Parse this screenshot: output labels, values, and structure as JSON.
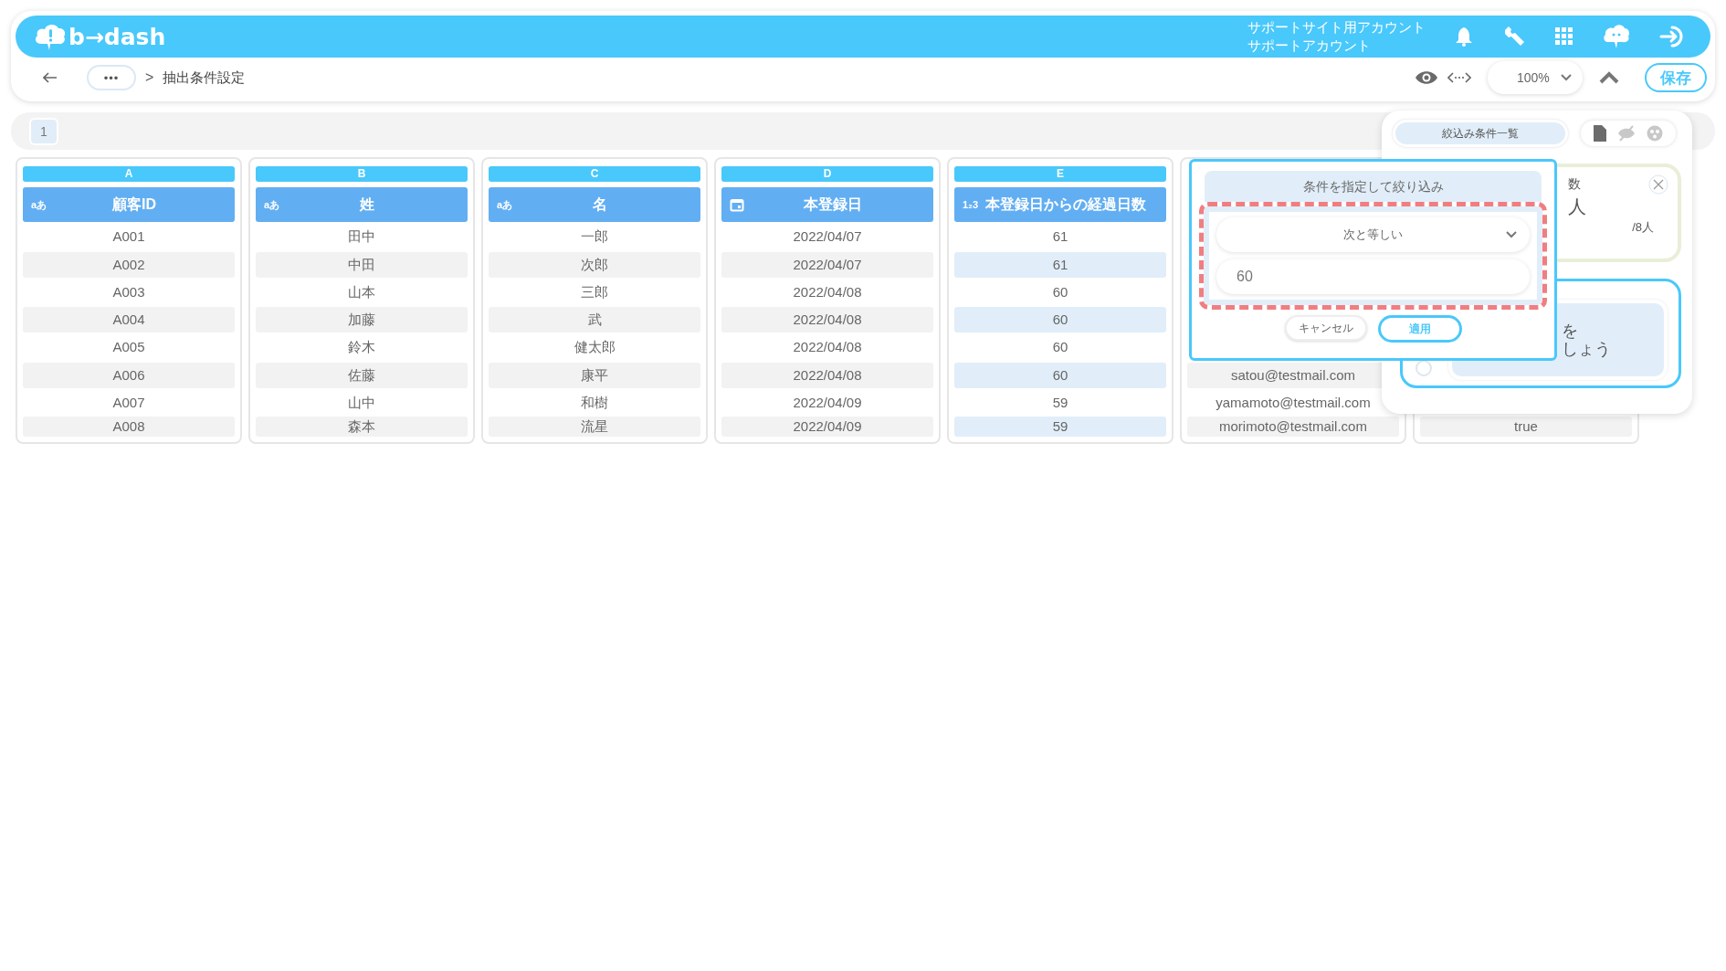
{
  "header": {
    "logo": "b→dash",
    "account_lines": [
      "サポートサイト用アカウント",
      "サポートアカウント"
    ]
  },
  "toolbar": {
    "more": "•••",
    "breadcrumb_separator": ">",
    "breadcrumb": "抽出条件設定",
    "zoom": "100%",
    "save": "保存"
  },
  "page_tabs": [
    {
      "label": "1",
      "selected": true
    }
  ],
  "columns": [
    {
      "letter": "A",
      "kind": "text",
      "type_icon": "aあ",
      "title": "顧客ID",
      "selected": false,
      "cells": [
        "A001",
        "A002",
        "A003",
        "A004",
        "A005",
        "A006",
        "A007",
        "A008"
      ]
    },
    {
      "letter": "B",
      "kind": "text",
      "type_icon": "aあ",
      "title": "姓",
      "selected": false,
      "cells": [
        "田中",
        "中田",
        "山本",
        "加藤",
        "鈴木",
        "佐藤",
        "山中",
        "森本"
      ]
    },
    {
      "letter": "C",
      "kind": "text",
      "type_icon": "aあ",
      "title": "名",
      "selected": false,
      "cells": [
        "一郎",
        "次郎",
        "三郎",
        "武",
        "健太郎",
        "康平",
        "和樹",
        "流星"
      ]
    },
    {
      "letter": "D",
      "kind": "date",
      "title": "本登録日",
      "selected": false,
      "cells": [
        "2022/04/07",
        "2022/04/07",
        "2022/04/08",
        "2022/04/08",
        "2022/04/08",
        "2022/04/08",
        "2022/04/09",
        "2022/04/09"
      ]
    },
    {
      "letter": "E",
      "kind": "number",
      "type_icon": "1₂3",
      "title": "本登録日からの経過日数",
      "selected": true,
      "cells": [
        "61",
        "61",
        "60",
        "60",
        "60",
        "60",
        "59",
        "59"
      ]
    },
    {
      "kind": "covered",
      "selected": false,
      "cells": [
        "satou@testmail.com",
        "yamamoto@testmail.com",
        "morimoto@testmail.com"
      ]
    },
    {
      "kind": "covered",
      "selected": false,
      "cells": [
        "true"
      ]
    }
  ],
  "filter_popup": {
    "title": "条件を指定して絞り込み",
    "operator": "次と等しい",
    "value": "60",
    "cancel": "キャンセル",
    "apply": "適用"
  },
  "side_panel": {
    "tab": {
      "label": "絞込み条件一覧",
      "selected": true
    },
    "card_1": {
      "label": "数",
      "count": "人",
      "total": "/8人"
    },
    "card_2": {
      "selected": false,
      "lines": [
        "を",
        "しょう"
      ]
    }
  }
}
